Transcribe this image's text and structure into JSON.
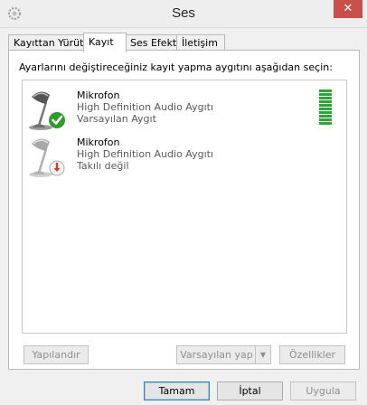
{
  "window": {
    "title": "Ses",
    "close_glyph": "✕"
  },
  "tabs": [
    {
      "label": "Kayıttan Yürüt",
      "active": false
    },
    {
      "label": "Kayıt",
      "active": true
    },
    {
      "label": "Ses Efekti",
      "active": false
    },
    {
      "label": "İletişim",
      "active": false
    }
  ],
  "panel": {
    "instructions": "Ayarlarını değiştireceğiniz kayıt yapma aygıtını aşağıdan seçin:"
  },
  "devices": [
    {
      "name": "Mikrofon",
      "driver": "High Definition Audio Aygıtı",
      "status": "Varsayılan Aygıt",
      "icon": "microphone-icon",
      "badge": "default-check-icon",
      "input_level_segments_lit": 10,
      "input_level_segments_total": 10
    },
    {
      "name": "Mikrofon",
      "driver": "High Definition Audio Aygıtı",
      "status": "Takılı değil",
      "icon": "microphone-icon",
      "badge": "unplugged-icon"
    }
  ],
  "panel_buttons": {
    "configure": "Yapılandır",
    "set_default": "Varsayılan yap",
    "properties": "Özellikler"
  },
  "dialog_buttons": {
    "ok": "Tamam",
    "cancel": "İptal",
    "apply": "Uygula"
  },
  "colors": {
    "accent": "#3c7fb1",
    "level_meter": "#2fa63a",
    "close_button": "#c7504d",
    "default_badge": "#2d9c2d",
    "unplugged_badge": "#d23a2a"
  }
}
